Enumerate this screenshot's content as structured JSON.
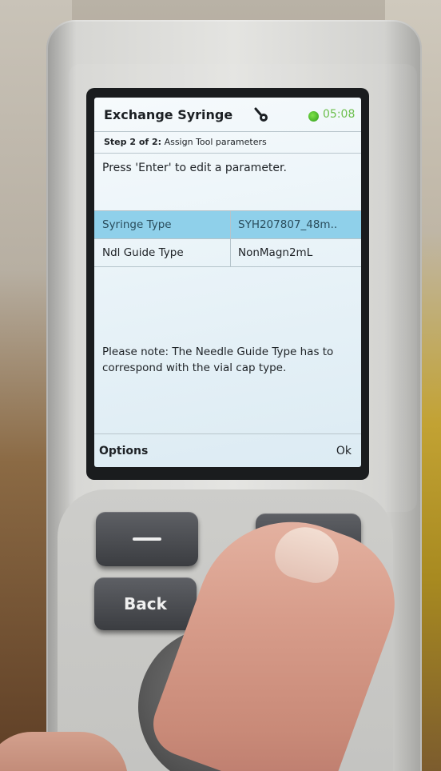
{
  "screen": {
    "title": "Exchange Syringe",
    "clock": "05:08",
    "step_label": "Step 2 of 2:",
    "step_description": "Assign Tool parameters",
    "instruction": "Press 'Enter' to edit a parameter.",
    "parameters": [
      {
        "name": "Syringe Type",
        "value": "SYH207807_48m..",
        "selected": true
      },
      {
        "name": "Ndl Guide Type",
        "value": "NonMagn2mL",
        "selected": false
      }
    ],
    "note": "Please note: The Needle Guide Type has to correspond with the vial cap type.",
    "softkeys": {
      "left": "Options",
      "right": "Ok"
    }
  },
  "keypad": {
    "back_label": "Back"
  },
  "icons": {
    "tool": "wrench-icon",
    "status": "status-icon"
  },
  "colors": {
    "selected_row": "#8fd0ea",
    "status_green": "#3ab02a",
    "clock": "#6cbf4c"
  }
}
